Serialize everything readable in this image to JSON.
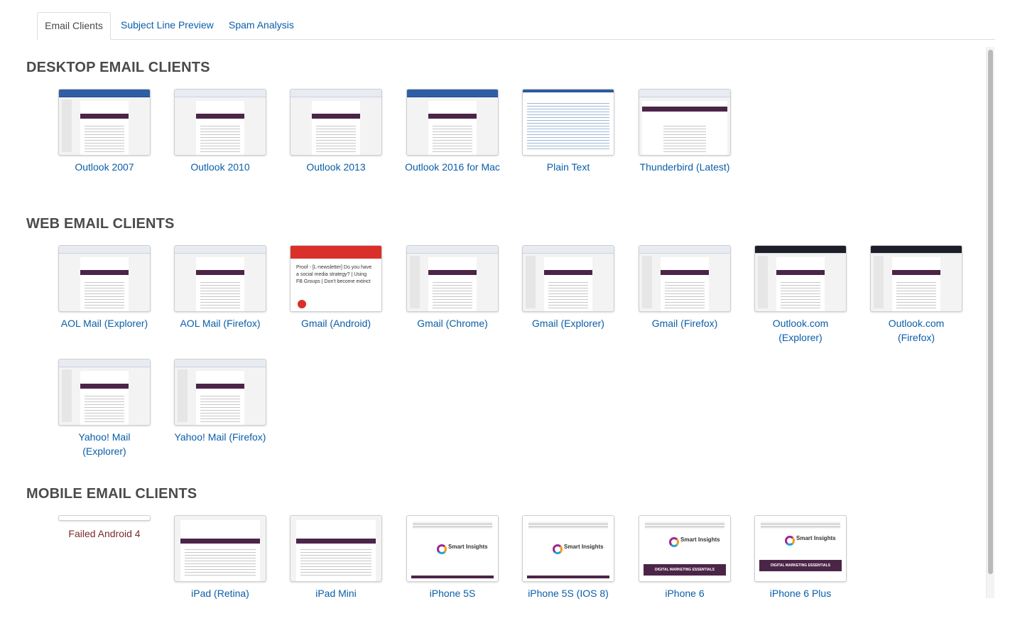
{
  "tabs": [
    {
      "label": "Email Clients",
      "active": true
    },
    {
      "label": "Subject Line Preview",
      "active": false
    },
    {
      "label": "Spam Analysis",
      "active": false
    }
  ],
  "sections": {
    "desktop": {
      "title": "DESKTOP EMAIL CLIENTS",
      "clients": [
        "Outlook 2007",
        "Outlook 2010",
        "Outlook 2013",
        "Outlook 2016 for Mac",
        "Plain Text",
        "Thunderbird (Latest)"
      ]
    },
    "web": {
      "title": "WEB EMAIL CLIENTS",
      "clients": [
        "AOL Mail (Explorer)",
        "AOL Mail (Firefox)",
        "Gmail (Android)",
        "Gmail (Chrome)",
        "Gmail (Explorer)",
        "Gmail (Firefox)",
        "Outlook.com (Explorer)",
        "Outlook.com (Firefox)",
        "Yahoo! Mail (Explorer)",
        "Yahoo! Mail (Firefox)"
      ]
    },
    "mobile": {
      "title": "MOBILE EMAIL CLIENTS",
      "clients": [
        "Failed Android 4",
        "iPad (Retina)",
        "iPad Mini",
        "iPhone 5S",
        "iPhone 5S (IOS 8)",
        "iPhone 6",
        "iPhone 6 Plus"
      ]
    }
  },
  "gmail_android_preview": "Proof - [L-newsletter] Do you have a social media strategy? | Using FB Groups | Don't become extinct",
  "logo_text": "Smart Insights",
  "mobile_bar_text": "DIGITAL MARKETING ESSENTIALS",
  "colors": {
    "link": "#0a5ea8",
    "brand_bar": "#4b2547",
    "failed": "#7a2b2b",
    "gmail_red": "#d9312a"
  }
}
